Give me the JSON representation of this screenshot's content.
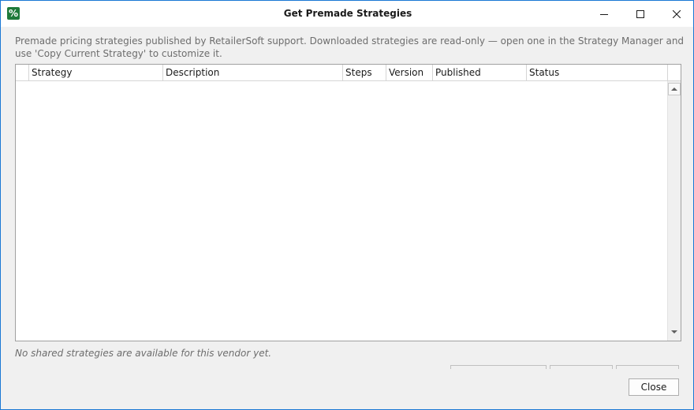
{
  "window": {
    "title": "Get Premade Strategies",
    "app_icon_glyph": "%",
    "accent_color": "#1a78d4",
    "icon_color": "#1e7a3a"
  },
  "description": "Premade pricing strategies published by RetailerSoft support. Downloaded strategies are read-only — open one in the Strategy Manager and use 'Copy Current Strategy' to customize it.",
  "grid": {
    "columns": [
      "Strategy",
      "Description",
      "Steps",
      "Version",
      "Published",
      "Status"
    ],
    "rows": []
  },
  "empty_message": "No shared strategies are available for this vendor yet.",
  "buttons": {
    "close_label": "Close"
  }
}
